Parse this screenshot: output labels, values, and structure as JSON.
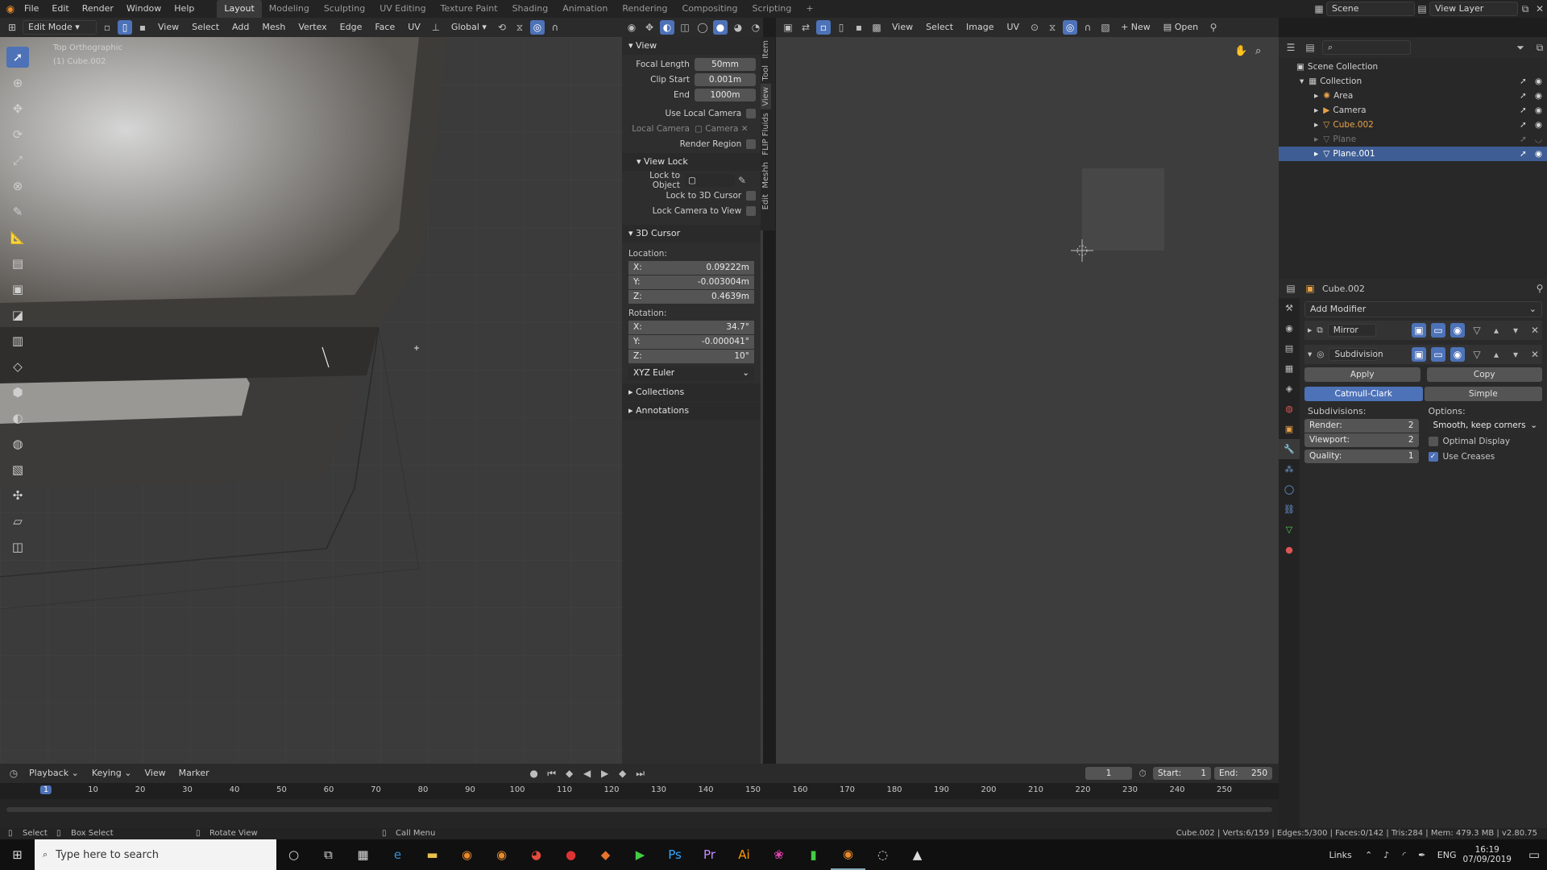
{
  "topbar": {
    "menus": [
      "File",
      "Edit",
      "Render",
      "Window",
      "Help"
    ],
    "workspaces": [
      "Layout",
      "Modeling",
      "Sculpting",
      "UV Editing",
      "Texture Paint",
      "Shading",
      "Animation",
      "Rendering",
      "Compositing",
      "Scripting"
    ],
    "scene": "Scene",
    "view_layer": "View Layer"
  },
  "viewport_header": {
    "mode": "Edit Mode",
    "menus": [
      "View",
      "Select",
      "Add",
      "Mesh",
      "Vertex",
      "Edge",
      "Face",
      "UV"
    ],
    "orientation": "Global"
  },
  "uv_header": {
    "menus": [
      "View",
      "Select",
      "Image",
      "UV"
    ],
    "new_label": "New",
    "open_label": "Open"
  },
  "viewport": {
    "view_name": "Top Orthographic",
    "object_name": "(1) Cube.002"
  },
  "npanel": {
    "view_title": "View",
    "focal_length_label": "Focal Length",
    "focal_length": "50mm",
    "clip_start_label": "Clip Start",
    "clip_start": "0.001m",
    "end_label": "End",
    "end": "1000m",
    "use_local_camera": "Use Local Camera",
    "local_camera_label": "Local Camera",
    "local_camera_value": "Camera",
    "render_region": "Render Region",
    "view_lock_title": "View Lock",
    "lock_to_object": "Lock to Object",
    "lock_to_cursor": "Lock to 3D Cursor",
    "lock_camera": "Lock Camera to View",
    "cursor_title": "3D Cursor",
    "location_label": "Location:",
    "loc_x": "0.09222m",
    "loc_y": "-0.003004m",
    "loc_z": "0.4639m",
    "rotation_label": "Rotation:",
    "rot_x": "34.7°",
    "rot_y": "-0.000041°",
    "rot_z": "10°",
    "x": "X:",
    "y": "Y:",
    "z": "Z:",
    "rotation_mode": "XYZ Euler",
    "collections": "Collections",
    "annotations": "Annotations",
    "tabs": [
      "Item",
      "Tool",
      "View",
      "FLIP Fluids",
      "Meshh",
      "Edit"
    ]
  },
  "outliner": {
    "scene_collection": "Scene Collection",
    "collection": "Collection",
    "items": [
      "Area",
      "Camera",
      "Cube.002",
      "Plane",
      "Plane.001"
    ]
  },
  "properties": {
    "object_name": "Cube.002",
    "add_modifier": "Add Modifier",
    "mirror": "Mirror",
    "subdivision": "Subdivision",
    "apply": "Apply",
    "copy": "Copy",
    "catmull": "Catmull-Clark",
    "simple": "Simple",
    "subdivisions_label": "Subdivisions:",
    "options_label": "Options:",
    "render_label": "Render:",
    "render_value": "2",
    "viewport_label": "Viewport:",
    "viewport_value": "2",
    "quality_label": "Quality:",
    "quality_value": "1",
    "smooth_option": "Smooth, keep corners",
    "optimal_display": "Optimal Display",
    "use_creases": "Use Creases"
  },
  "timeline": {
    "menus": [
      "Playback",
      "Keying",
      "View",
      "Marker"
    ],
    "current_frame": "1",
    "start_label": "Start:",
    "start": "1",
    "end_label": "End:",
    "end": "250",
    "ticks": [
      "1",
      "10",
      "20",
      "30",
      "40",
      "50",
      "60",
      "70",
      "80",
      "90",
      "100",
      "110",
      "120",
      "130",
      "140",
      "150",
      "160",
      "170",
      "180",
      "190",
      "200",
      "210",
      "220",
      "230",
      "240",
      "250"
    ]
  },
  "statusbar": {
    "select": "Select",
    "box_select": "Box Select",
    "rotate_view": "Rotate View",
    "call_menu": "Call Menu",
    "stats": "Cube.002 | Verts:6/159 | Edges:5/300 | Faces:0/142 | Tris:284 | Mem: 479.3 MB | v2.80.75"
  },
  "taskbar": {
    "search_placeholder": "Type here to search",
    "links": "Links",
    "lang": "ENG",
    "time": "16:19",
    "date": "07/09/2019"
  },
  "colors": {
    "accent": "#4d72b8",
    "selection": "#3e5d94",
    "active_object": "#e8a34a"
  }
}
